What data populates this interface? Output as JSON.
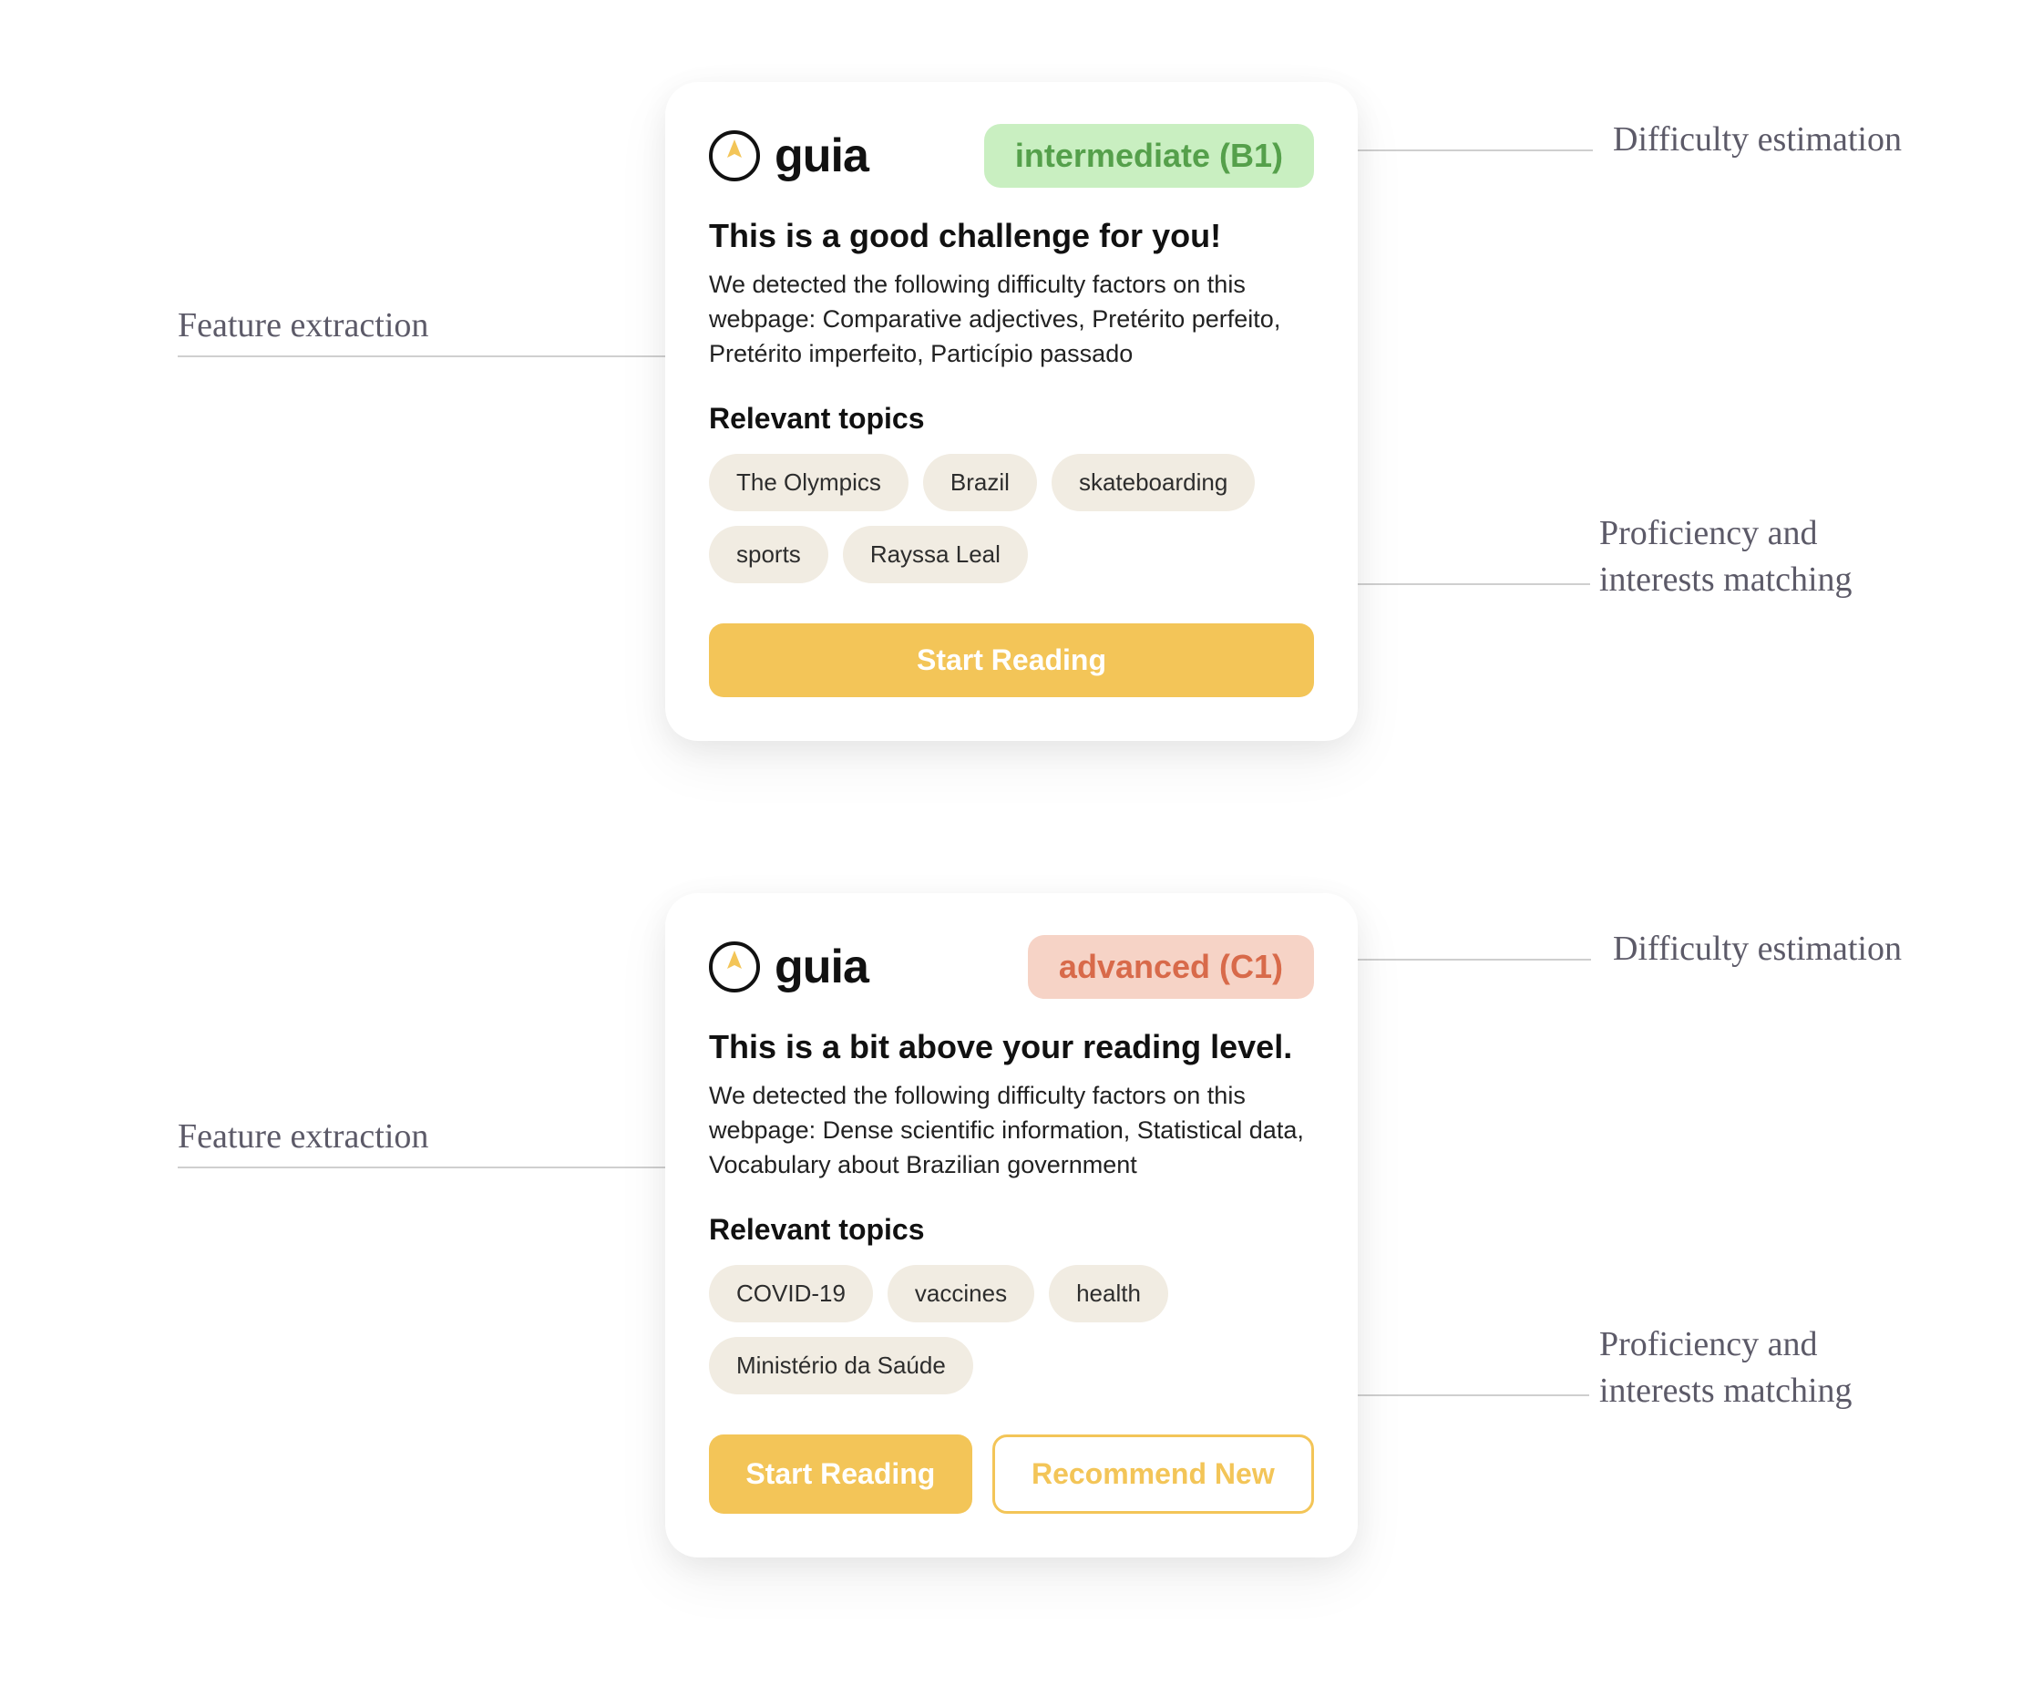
{
  "brand": "guia",
  "annotations": {
    "difficulty": "Difficulty estimation",
    "feature": "Feature extraction",
    "matching": "Proficiency and\ninterests matching"
  },
  "cards": [
    {
      "level_label": "intermediate (B1)",
      "level_class": "b1",
      "title": "This is a good challenge for you!",
      "description": "We detected the following difficulty factors on this webpage: Comparative adjectives, Pretérito perfeito, Pretérito imperfeito, Particípio passado",
      "topics_heading": "Relevant topics",
      "topics": [
        "The Olympics",
        "Brazil",
        "skateboarding",
        "sports",
        "Rayssa Leal"
      ],
      "buttons": [
        {
          "label": "Start Reading",
          "style": "primary"
        }
      ]
    },
    {
      "level_label": "advanced (C1)",
      "level_class": "c1",
      "title": "This is a bit above your reading level.",
      "description": "We detected the following difficulty factors on this webpage: Dense scientific information, Statistical data, Vocabulary about Brazilian government",
      "topics_heading": "Relevant topics",
      "topics": [
        "COVID-19",
        "vaccines",
        "health",
        "Ministério da Saúde"
      ],
      "buttons": [
        {
          "label": "Start Reading",
          "style": "primary"
        },
        {
          "label": "Recommend New",
          "style": "secondary"
        }
      ]
    }
  ]
}
